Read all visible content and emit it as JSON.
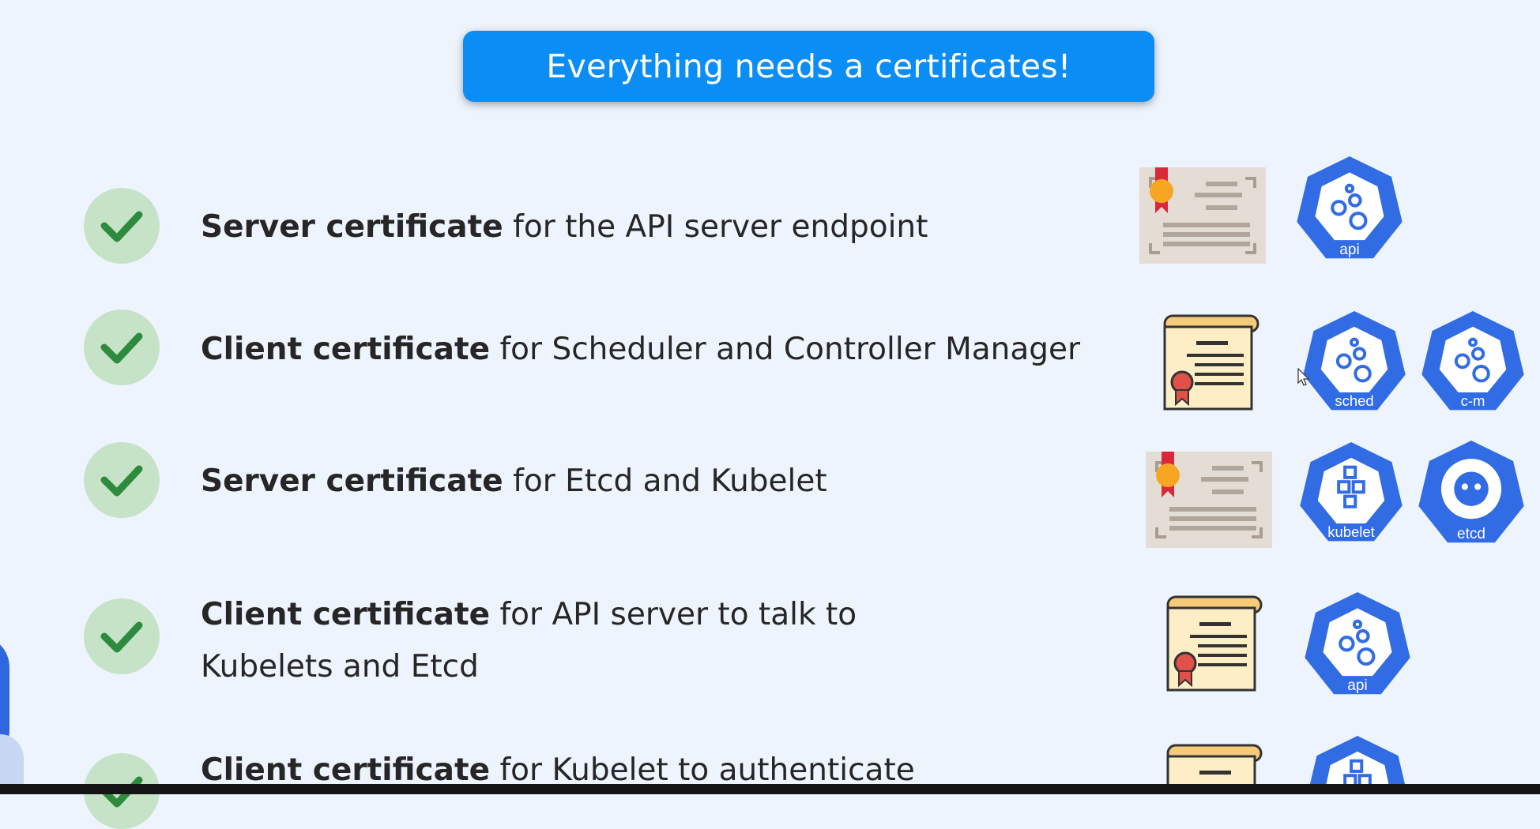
{
  "banner": {
    "title": "Everything needs a certificates!"
  },
  "rows": [
    {
      "bold": "Server certificate",
      "rest": " for the API server endpoint",
      "line2": "",
      "cert_type": "server",
      "components": [
        "api"
      ]
    },
    {
      "bold": "Client certificate",
      "rest": " for Scheduler and Controller Manager",
      "line2": "",
      "cert_type": "client",
      "components": [
        "sched",
        "c-m"
      ]
    },
    {
      "bold": "Server certificate",
      "rest": " for Etcd and Kubelet",
      "line2": "",
      "cert_type": "server",
      "components": [
        "kubelet",
        "etcd"
      ]
    },
    {
      "bold": "Client certificate",
      "rest": " for API server to talk to",
      "line2": "Kubelets and Etcd",
      "cert_type": "client",
      "components": [
        "api"
      ]
    },
    {
      "bold": "Client certificate",
      "rest": " for Kubelet to authenticate",
      "line2": "",
      "cert_type": "client",
      "components": [
        ""
      ]
    }
  ],
  "icons": [
    "check-icon",
    "server-certificate-icon",
    "client-certificate-icon",
    "kubernetes-component-icon"
  ],
  "colors": {
    "banner": "#0a8df5",
    "check_bg": "#c6e3c8",
    "check_mark": "#2e8b3e",
    "k8s_blue": "#326ce5",
    "background": "#eef4fd"
  }
}
